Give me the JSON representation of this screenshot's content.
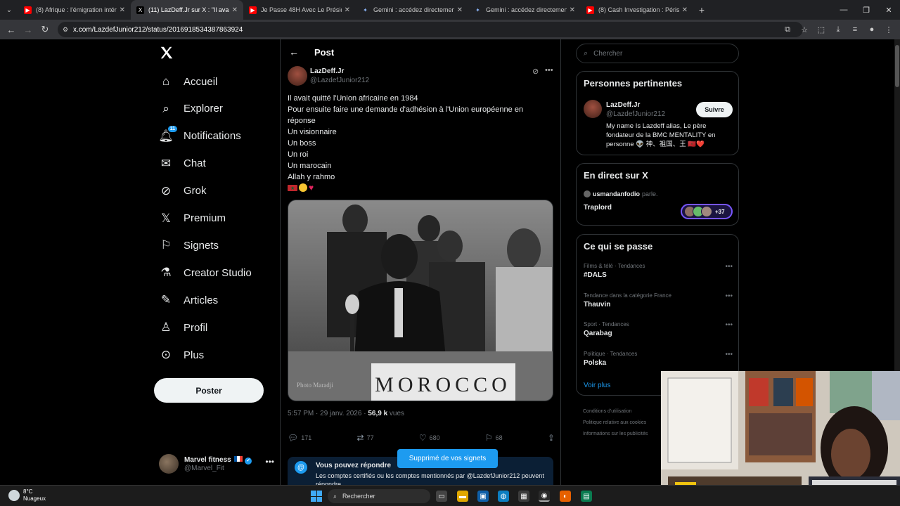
{
  "browser": {
    "tabs": [
      {
        "title": "(8) Afrique : l'émigration intérie",
        "favicon": "youtube-icon",
        "color": "#ff0000"
      },
      {
        "title": "(11) LazDeff.Jr sur X : \"Il avait qu",
        "favicon": "x-icon",
        "color": "#000000"
      },
      {
        "title": "Je Passe 48H Avec Le Président",
        "favicon": "youtube-icon",
        "color": "#ff0000"
      },
      {
        "title": "Gemini : accédez directement a",
        "favicon": "gemini-icon",
        "color": "#8ab4f8"
      },
      {
        "title": "Gemini : accédez directement a",
        "favicon": "gemini-icon",
        "color": "#8ab4f8"
      },
      {
        "title": "(8) Cash Investigation : Périscol",
        "favicon": "youtube-icon",
        "color": "#ff0000"
      }
    ],
    "url": "x.com/LazdefJunior212/status/2016918534387863924"
  },
  "nav": {
    "items": [
      "Accueil",
      "Explorer",
      "Notifications",
      "Chat",
      "Grok",
      "Premium",
      "Signets",
      "Creator Studio",
      "Articles",
      "Profil",
      "Plus"
    ],
    "notif_badge": "11",
    "post_button": "Poster",
    "account_name": "Marvel fitness",
    "account_handle": "@Marvel_Fit"
  },
  "post": {
    "header": "Post",
    "author_name": "LazDeff.Jr",
    "author_handle": "@LazdefJunior212",
    "lines": [
      "Il avait quitté l'Union africaine en 1984",
      "Pour ensuite faire une demande d'adhésion à l'Union européenne en",
      "réponse",
      "Un visionnaire",
      "Un boss",
      "Un roi",
      "Un marocain",
      "Allah y rahmo"
    ],
    "photo_sign": "MOROCCO",
    "photo_credit": "Photo Maradji",
    "time": "5:57 PM · 29 janv. 2026 · ",
    "views": "56,9 k",
    "views_label": " vues",
    "replies": "171",
    "reposts": "77",
    "likes": "680",
    "bookmarks": "68",
    "reply_title": "Vous pouvez répondre",
    "reply_desc": "Les comptes certifiés ou les comptes mentionnés par @LazdefJunior212 peuvent répondre"
  },
  "toast": "Supprimé de vos signets",
  "sidebar": {
    "search_placeholder": "Chercher",
    "relevant": {
      "title": "Personnes pertinentes",
      "name": "LazDeff.Jr",
      "handle": "@LazdefJunior212",
      "follow": "Suivre",
      "bio": "My name Is Lazdeff alias, Le père fondateur de la BMC MENTALITY en personne 👽 神、祖国、王 🇲🇦❤️"
    },
    "live": {
      "title": "En direct sur X",
      "user": "usmandanfodio",
      "speaking": "parle.",
      "space": "Traplord",
      "count": "+37"
    },
    "trends": {
      "title": "Ce qui se passe",
      "items": [
        {
          "meta": "Films & télé · Tendances",
          "name": "#DALS"
        },
        {
          "meta": "Tendance dans la catégorie France",
          "name": "Thauvin"
        },
        {
          "meta": "Sport · Tendances",
          "name": "Qarabag"
        },
        {
          "meta": "Politique · Tendances",
          "name": "Polska"
        }
      ],
      "see_more": "Voir plus"
    },
    "footer": [
      "Conditions d'utilisation",
      "Politique relative aux cookies",
      "Informations sur les publicités"
    ]
  },
  "taskbar": {
    "temp": "8°C",
    "condition": "Nuageux",
    "search": "Rechercher"
  }
}
